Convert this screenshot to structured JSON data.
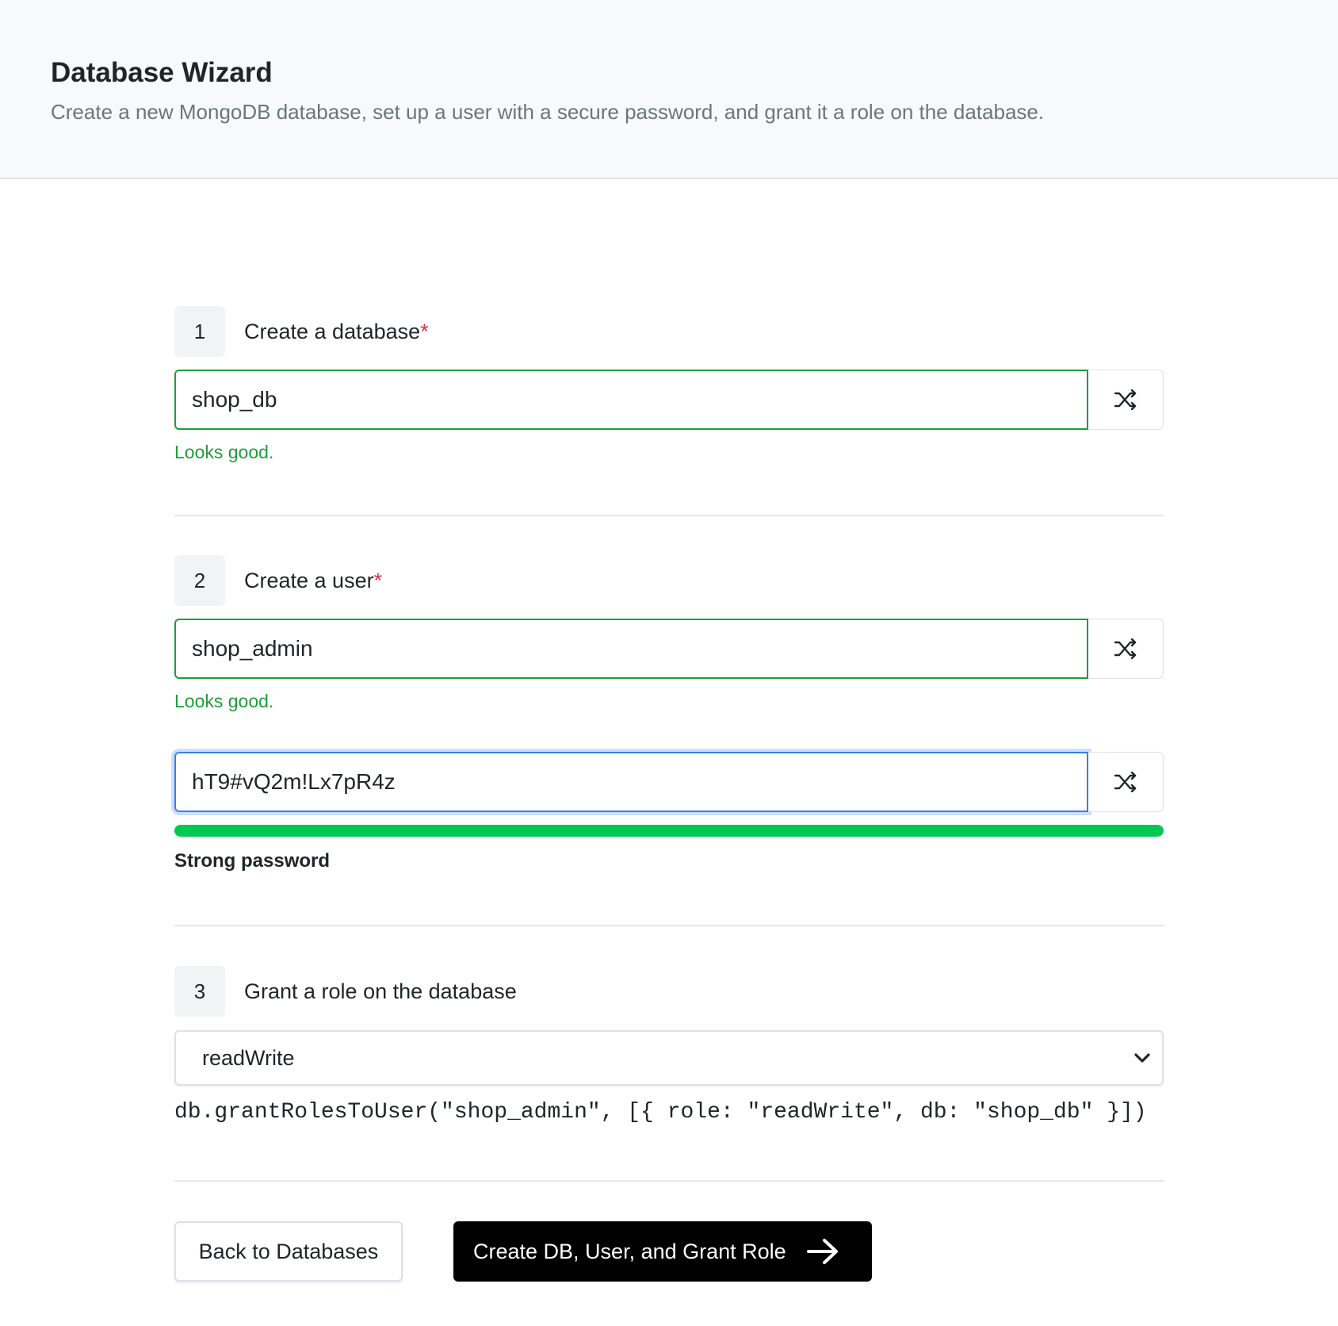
{
  "header": {
    "title": "Database Wizard",
    "subtitle": "Create a new MongoDB database, set up a user with a secure password, and grant it a role on the database."
  },
  "steps": [
    {
      "number": "1",
      "title": "Create a database",
      "required_mark": "*",
      "input_value": "shop_db",
      "validation": "Looks good.",
      "shuffle_icon": "shuffle-icon"
    },
    {
      "number": "2",
      "title": "Create a user",
      "required_mark": "*",
      "username_value": "shop_admin",
      "username_validation": "Looks good.",
      "password_value": "hT9#vQ2m!Lx7pR4z",
      "password_strength": 1.0,
      "password_strength_label": "Strong password",
      "shuffle_icon": "shuffle-icon"
    },
    {
      "number": "3",
      "title": "Grant a role on the database",
      "role_selected": "readWrite",
      "command_preview": "db.grantRolesToUser(\"shop_admin\", [{ role: \"readWrite\", db: \"shop_db\" }])"
    }
  ],
  "actions": {
    "back_label": "Back to Databases",
    "create_label": "Create DB, User, and Grant Role",
    "create_icon": "arrow-right-icon"
  },
  "colors": {
    "valid": "#1e9e3a",
    "required": "#dc3545",
    "strength_fill": "#00c853",
    "focus": "#3d7fe0",
    "primary_button": "#000000"
  }
}
